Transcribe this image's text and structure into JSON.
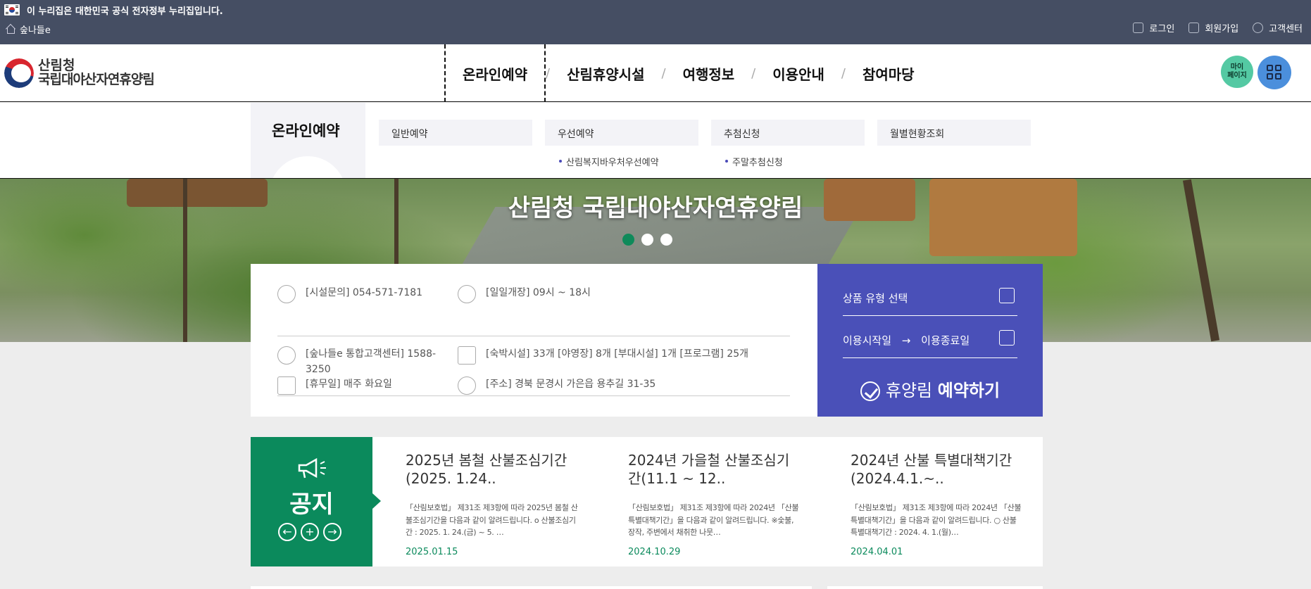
{
  "govbar": {
    "notice": "이 누리집은 대한민국 공식 전자정부 누리집입니다.",
    "home_label": "숲나들e",
    "login": "로그인",
    "signup": "회원가입",
    "support": "고객센터"
  },
  "header": {
    "logo_line1": "산림청",
    "logo_line2": "국립대야산자연휴양림",
    "nav": [
      "온라인예약",
      "산림휴양시설",
      "여행정보",
      "이용안내",
      "참여마당"
    ],
    "mypage": "마이\n페이지"
  },
  "dropdown": {
    "title": "온라인예약",
    "columns": [
      {
        "label": "일반예약",
        "subs": []
      },
      {
        "label": "우선예약",
        "subs": [
          "산림복지바우처우선예약"
        ]
      },
      {
        "label": "추첨신청",
        "subs": [
          "주말추첨신청"
        ]
      },
      {
        "label": "월별현황조회",
        "subs": []
      }
    ]
  },
  "hero": {
    "title": "산림청 국립대야산자연휴양림",
    "slides": 3,
    "active_slide": 1
  },
  "info": {
    "facility_phone": "[시설문의] 054-571-7181",
    "hours": "[일일개장] 09시 ~ 18시",
    "callcenter": "[숲나들e 통합고객센터] 1588-3250",
    "facilities": "[숙박시설] 33개 [야영장] 8개 [부대시설] 1개 [프로그램] 25개",
    "closed": "[휴무일] 매주 화요일",
    "address": "[주소] 경북 문경시 가은읍 용추길 31-35"
  },
  "booking": {
    "product_select": "상품 유형 선택",
    "start": "이용시작일",
    "arrow": "→",
    "end": "이용종료일",
    "btn_light": "휴양림 ",
    "btn_bold": "예약하기"
  },
  "notice": {
    "label": "공지",
    "prev": "←",
    "more": "+",
    "next": "→",
    "posts": [
      {
        "title": "2025년 봄철 산불조심기간(2025. 1.24..",
        "body": "「산림보호법」 제31조 제3항에 따라 2025년 봄철 산불조심기간을 다음과 같이 알려드립니다. o 산불조심기간 : 2025. 1. 24.(금) ~ 5. …",
        "date": "2025.01.15"
      },
      {
        "title": "2024년 가을철 산불조심기간(11.1 ~ 12..",
        "body": "「산림보호법」 제31조 제3항에 따라 2024년 「산불 특별대책기간」을 다음과 같이 알려드립니다. ※숯불, 장작, 주변에서 채취한 나뭇…",
        "date": "2024.10.29"
      },
      {
        "title": "2024년 산불 특별대책기간(2024.4.1.~..",
        "body": "「산림보호법」 제31조 제3항에 따라 2024년 「산불 특별대책기간」을 다음과 같이 알려드립니다. ○ 산불특별대책기간 : 2024. 4. 1.(월)…",
        "date": "2024.04.01"
      }
    ]
  }
}
